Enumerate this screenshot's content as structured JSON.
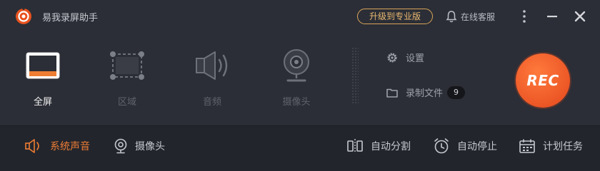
{
  "app": {
    "title": "易我录屏助手"
  },
  "header": {
    "upgrade_label": "升级到专业版",
    "support_label": "在线客服"
  },
  "modes": [
    {
      "label": "全屏",
      "icon": "monitor-icon",
      "active": true
    },
    {
      "label": "区域",
      "icon": "region-select-icon",
      "active": false
    },
    {
      "label": "音频",
      "icon": "speaker-icon",
      "active": false
    },
    {
      "label": "摄像头",
      "icon": "webcam-icon",
      "active": false
    }
  ],
  "side": {
    "settings_label": "设置",
    "recordings_label": "录制文件",
    "recordings_count": "9"
  },
  "rec_label": "REC",
  "bottom": {
    "system_sound_label": "系统声音",
    "webcam_label": "摄像头",
    "auto_split_label": "自动分割",
    "auto_stop_label": "自动停止",
    "schedule_label": "计划任务"
  },
  "colors": {
    "accent": "#ee7d34",
    "rec": "#e4471c",
    "upgrade_border": "#d8a45a"
  }
}
